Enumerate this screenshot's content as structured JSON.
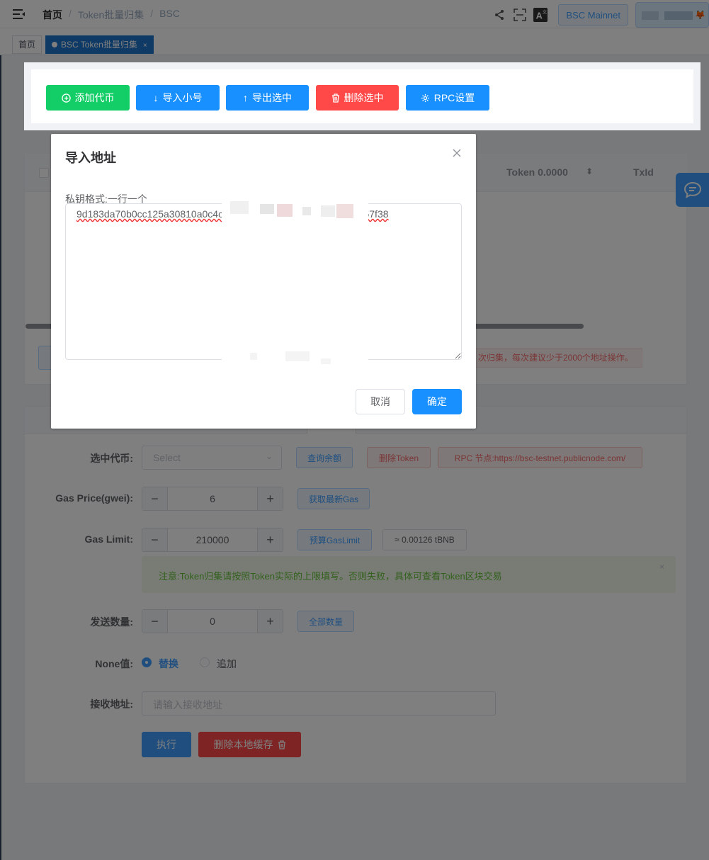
{
  "header": {
    "breadcrumb": [
      "首页",
      "Token批量归集",
      "BSC"
    ],
    "network_label": "BSC Mainnet"
  },
  "tags": [
    {
      "label": "首页"
    },
    {
      "label": "BSC Token批量归集"
    }
  ],
  "toolbar": {
    "add_token": "添加代币",
    "import_wallets": "导入小号",
    "export_selected": "导出选中",
    "delete_selected": "删除选中",
    "rpc_settings": "RPC设置"
  },
  "table": {
    "col_token": "Token 0.0000",
    "col_txid": "TxId"
  },
  "warning_tip": "次归集，每次建议少于2000个地址操作。",
  "form": {
    "token_label": "选中代币:",
    "token_placeholder": "Select",
    "query_balance": "查询余额",
    "delete_token": "删除Token",
    "rpc_node": "RPC 节点:https://bsc-testnet.publicnode.com/",
    "gas_price_label": "Gas Price(gwei):",
    "gas_price_value": "6",
    "get_gas": "获取最新Gas",
    "gas_limit_label": "Gas Limit:",
    "gas_limit_value": "210000",
    "estimate_gas": "预算GasLimit",
    "gas_cost": "≈ 0.00126 tBNB",
    "notice": "注意:Token归集请按照Token实际的上限填写。否则失败，具体可查看Token区块交易",
    "amount_label": "发送数量:",
    "amount_value": "0",
    "all_amount": "全部数量",
    "none_label": "None值:",
    "radio_replace": "替换",
    "radio_append": "追加",
    "receiver_label": "接收地址:",
    "receiver_placeholder": "请输入接收地址",
    "execute": "执行",
    "clear_cache": "删除本地缓存"
  },
  "modal": {
    "title": "导入地址",
    "field_label": "私钥格式:一行一个",
    "textarea_value": "9d183da70b0cc125a30810a0c4c                                          4f53057f38",
    "cancel": "取消",
    "confirm": "确定"
  },
  "colors": {
    "primary": "#1890ff",
    "success": "#13ce66",
    "danger": "#ff4949",
    "sidebar": "#304156"
  }
}
